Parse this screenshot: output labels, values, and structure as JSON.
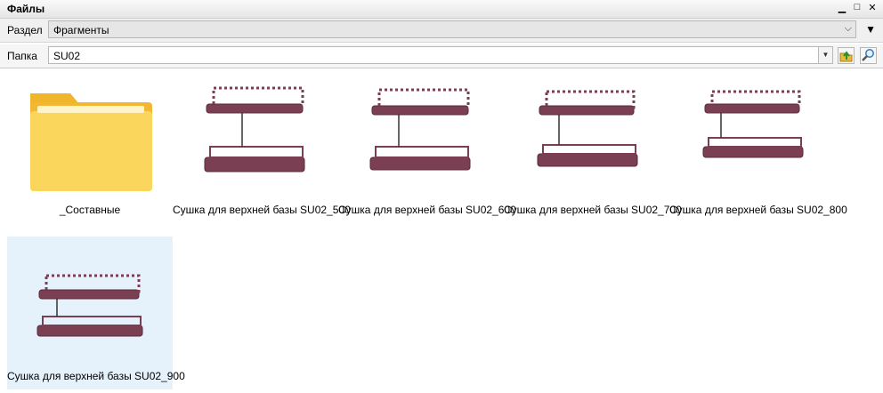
{
  "window": {
    "title": "Файлы"
  },
  "section": {
    "label": "Раздел",
    "value": "Фрагменты"
  },
  "folder": {
    "label": "Папка",
    "value": "SU02"
  },
  "items": [
    {
      "label": "_Составные",
      "kind": "folder"
    },
    {
      "label": "Сушка для верхней базы SU02_500",
      "kind": "model"
    },
    {
      "label": "Сушка для верхней базы SU02_600",
      "kind": "model"
    },
    {
      "label": "Сушка для верхней базы SU02_700",
      "kind": "model"
    },
    {
      "label": "Сушка для верхней базы SU02_800",
      "kind": "model"
    },
    {
      "label": "Сушка для верхней базы SU02_900",
      "kind": "model",
      "selected": true
    }
  ],
  "icons": {
    "folder_up": "folder-up-icon",
    "search": "search-icon"
  },
  "colors": {
    "selection": "#e5f1fb",
    "model": "#7a3f52",
    "folder": "#f7c544"
  }
}
